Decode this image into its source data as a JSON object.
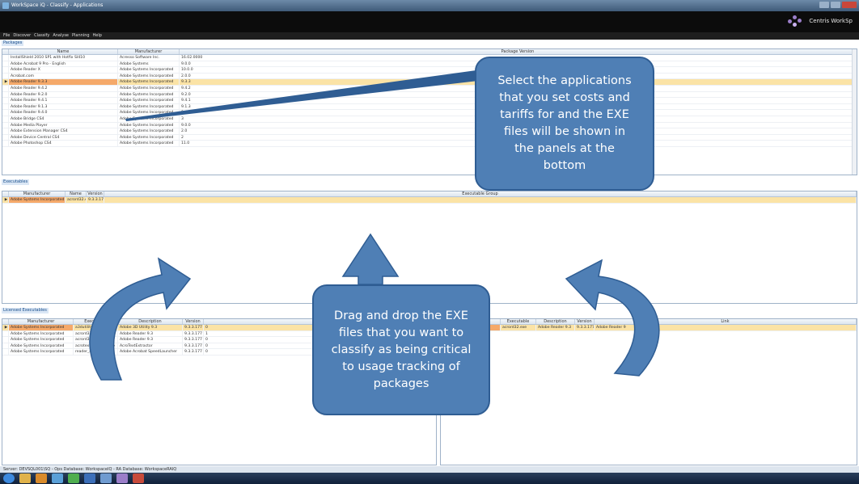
{
  "window": {
    "title": "WorkSpace iQ - Classify - Applications"
  },
  "brand": {
    "name": "Centris WorkSp"
  },
  "menu": [
    "File",
    "Discover",
    "Classify",
    "Analyse",
    "Planning",
    "Help"
  ],
  "packages": {
    "label": "Packages",
    "columns": [
      "Name",
      "Manufacturer",
      "Package Version"
    ],
    "selected_row": 4,
    "rows": [
      [
        "InstallShield 2010 SP1 with Hotfix SI410",
        "Acresso Software Inc.",
        "16.02.0000"
      ],
      [
        "Adobe Acrobat 9 Pro - English",
        "Adobe Systems",
        "9.0.0"
      ],
      [
        "Adobe Reader X",
        "Adobe Systems Incorporated",
        "10.0.0"
      ],
      [
        "Acrobat.com",
        "Adobe Systems Incorporated",
        "2.0.0"
      ],
      [
        "Adobe Reader 9.3.3",
        "Adobe Systems Incorporated",
        "9.3.3"
      ],
      [
        "Adobe Reader 9.4.2",
        "Adobe Systems Incorporated",
        "9.4.2"
      ],
      [
        "Adobe Reader 9.2.0",
        "Adobe Systems Incorporated",
        "9.2.0"
      ],
      [
        "Adobe Reader 9.4.1",
        "Adobe Systems Incorporated",
        "9.4.1"
      ],
      [
        "Adobe Reader 9.1.3",
        "Adobe Systems Incorporated",
        "9.1.3"
      ],
      [
        "Adobe Reader 9.4.0",
        "Adobe Systems Incorporated",
        "9.4.0"
      ],
      [
        "Adobe Bridge CS4",
        "Adobe Systems Incorporated",
        "3"
      ],
      [
        "Adobe Media Player",
        "Adobe Systems Incorporated",
        "9.0.0"
      ],
      [
        "Adobe Extension Manager CS4",
        "Adobe Systems Incorporated",
        "2.0"
      ],
      [
        "Adobe Device Central CS4",
        "Adobe Systems Incorporated",
        "2"
      ],
      [
        "Adobe Photoshop CS4",
        "Adobe Systems Incorporated",
        "11.0"
      ]
    ]
  },
  "executables": {
    "label": "Executables",
    "columns": [
      "Manufacturer",
      "Name",
      "Version",
      "Executable Group"
    ],
    "rows": [
      [
        "Adobe Systems Incorporated",
        "acrord32.exe",
        "9.3.3.177",
        ""
      ]
    ]
  },
  "licensed": {
    "label": "Licensed Executables",
    "columns": [
      "Manufacturer",
      "Executable",
      "Description",
      "Version",
      "Us"
    ],
    "rows": [
      [
        "Adobe Systems Incorporated",
        "a3dutility.exe",
        "Adobe 3D Utility 9.3",
        "9.3.3.177",
        "0"
      ],
      [
        "Adobe Systems Incorporated",
        "acrord32.exe",
        "Adobe Reader 9.3",
        "9.3.3.177",
        "1"
      ],
      [
        "Adobe Systems Incorporated",
        "acrord32info.exe",
        "Adobe Reader 9.3",
        "9.3.3.177",
        "0"
      ],
      [
        "Adobe Systems Incorporated",
        "acrotextextractor.exe",
        "AcroTextExtractor",
        "9.3.3.177",
        "0"
      ],
      [
        "Adobe Systems Incorporated",
        "reader_sl.exe",
        "Adobe Acrobat SpeedLauncher",
        "9.3.3.177",
        "0"
      ]
    ]
  },
  "links": {
    "columns": [
      "",
      "Executable",
      "Description",
      "Version",
      "Link"
    ],
    "rows": [
      [
        "rated",
        "acrord32.exe",
        "Adobe Reader 9.3",
        "9.3.3.177",
        "Adobe Reader 9"
      ]
    ]
  },
  "status": "Server: DEVSQL001\\SQ - Ops Database: WorkspaceIQ - RA Database: WorkspaceRAIQ",
  "callouts": {
    "top": "Select the applications that you set costs and tariffs for and the EXE files will be shown in the panels at the bottom",
    "bottom": "Drag and drop the EXE files that you want to classify as being critical to usage tracking of packages"
  },
  "colors": {
    "callout": "#4f7fb5",
    "selection": "#fbe3a6",
    "highlight": "#f5a96a",
    "banner": "#0c0c0c"
  }
}
